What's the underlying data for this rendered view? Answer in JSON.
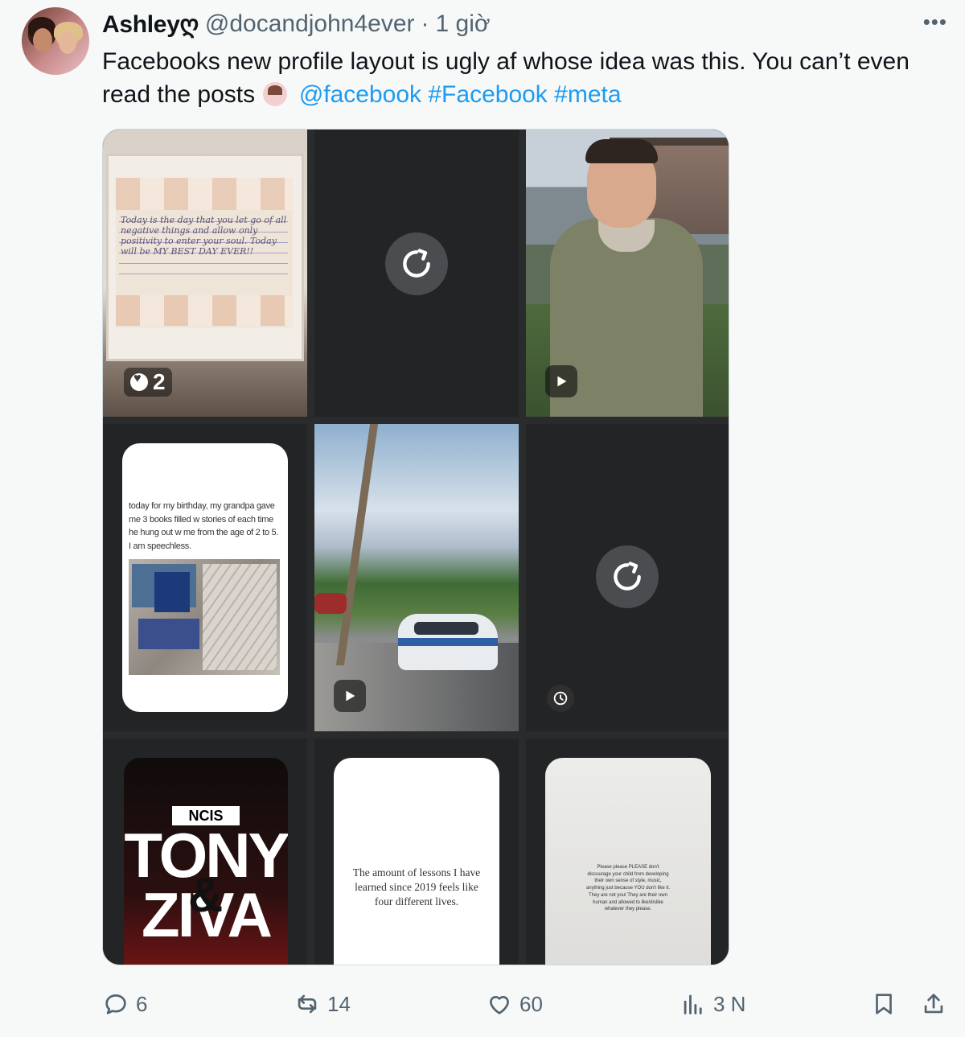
{
  "tweet": {
    "author_name": "Ashleyღ",
    "handle": "@docandjohn4ever",
    "separator": "·",
    "time": "1 giờ",
    "more_label": "•••",
    "text_main": "Facebooks new profile layout is ugly af whose idea was this. You can’t even read the posts",
    "mention": "@facebook",
    "hashtag1": "#Facebook",
    "hashtag2": "#meta"
  },
  "media": {
    "cell1": {
      "handwriting": "Today is the day that you let go of all negative things and allow only positivity to enter your soul. Today will be MY BEST DAY EVER!!",
      "like_count": "2"
    },
    "cell4": {
      "story_text": "today for my birthday, my grandpa gave me 3 books filled w stories of each time he hung out w me from the age of 2 to 5. I am speechless."
    },
    "cell7": {
      "ncis_label": "NCIS",
      "title_line1": "TONY",
      "amp": "&",
      "title_line2": "ZIVA"
    },
    "cell8": {
      "quote": "The amount of lessons I have learned since 2019 feels like four different lives."
    },
    "cell9": {
      "quote": "Please please PLEASE don't discourage your child from developing their own sense of style, music, anything just because YOU don't like it. They are not you! They are their own human and allowed to like/dislike whatever they please."
    }
  },
  "actions": {
    "replies": "6",
    "reposts": "14",
    "likes": "60",
    "views": "3 N"
  },
  "colors": {
    "link": "#1d9bf0",
    "muted": "#536471",
    "background": "#f7f9f9"
  },
  "icons": [
    "more-icon",
    "reload-icon",
    "play-icon",
    "history-icon",
    "heart-icon",
    "reply-icon",
    "repost-icon",
    "like-icon",
    "views-icon",
    "bookmark-icon",
    "share-icon"
  ]
}
